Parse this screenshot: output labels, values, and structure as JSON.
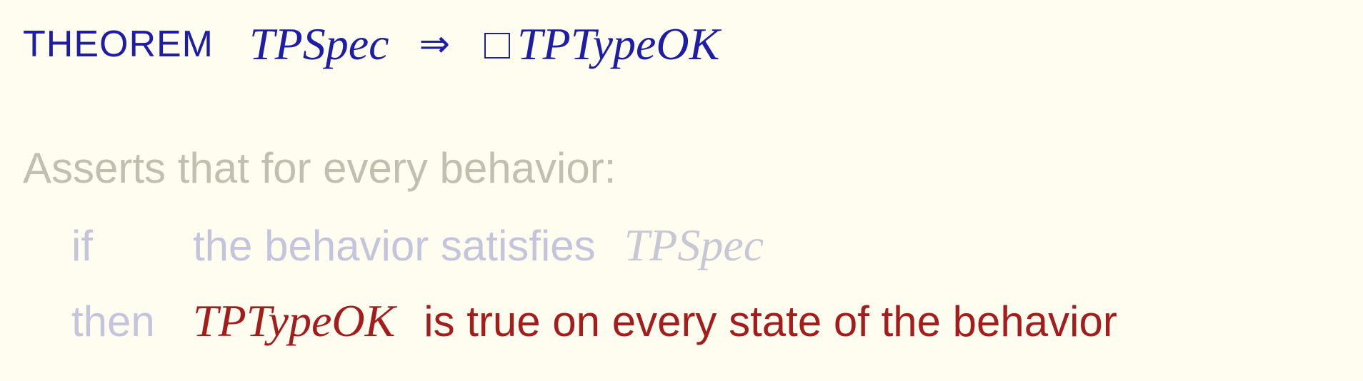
{
  "theorem": {
    "keyword": "THEOREM",
    "lhs": "TPSpec",
    "implies": "⇒",
    "rhs": "TPTypeOK"
  },
  "explanation": {
    "intro": "Asserts that for every behavior:",
    "if_word": "if",
    "if_text": "the behavior satisfies",
    "if_formula": "TPSpec",
    "then_word": "then",
    "then_formula": "TPTypeOK",
    "then_text": "is true on every state of the behavior"
  },
  "colors": {
    "background": "#fefdf0",
    "theorem": "#1d1da6",
    "highlight": "#a31d1d",
    "faded": "#c0c0b0"
  }
}
